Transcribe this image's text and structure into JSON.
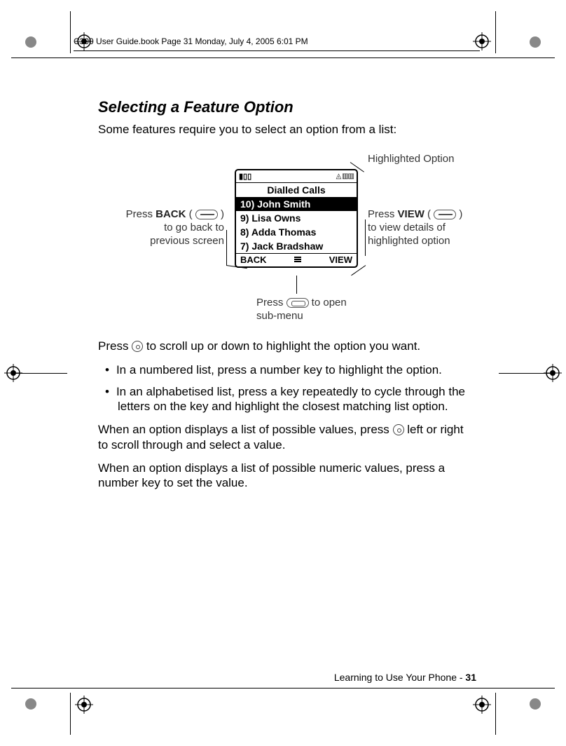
{
  "header": {
    "line": "C390 User Guide.book  Page 31  Monday, July 4, 2005  6:01 PM"
  },
  "title": "Selecting a Feature Option",
  "intro": "Some features require you to select an option from a list:",
  "diagram": {
    "screen_title": "Dialled Calls",
    "rows": [
      "10) John Smith",
      "9) Lisa Owns",
      "8) Adda Thomas",
      "7) Jack Bradshaw"
    ],
    "softkeys": {
      "left": "BACK",
      "right": "VIEW"
    },
    "callouts": {
      "highlighted": "Highlighted Option",
      "left1": "Press ",
      "left_bold": "BACK",
      "left2": " ( ",
      "left3": " )\nto go back to\nprevious screen",
      "right1": "Press ",
      "right_bold": "VIEW",
      "right2": " ( ",
      "right3": " )\nto view details of\nhighlighted option",
      "bottom1": "Press ",
      "bottom2": " to open\nsub-menu"
    }
  },
  "body": {
    "p1a": "Press ",
    "p1b": " to scroll up or down to highlight the option you want.",
    "li1": "In a numbered list, press a number key to highlight the option.",
    "li2": "In an alphabetised list, press a key repeatedly to cycle through the letters on the key and highlight the closest matching list option.",
    "p2a": "When an option displays a list of possible values, press ",
    "p2b": " left or right to scroll through and select a value.",
    "p3": "When an option displays a list of possible numeric values, press a number key to set the value."
  },
  "footer": {
    "text": "Learning to Use Your Phone - ",
    "page": "31"
  }
}
